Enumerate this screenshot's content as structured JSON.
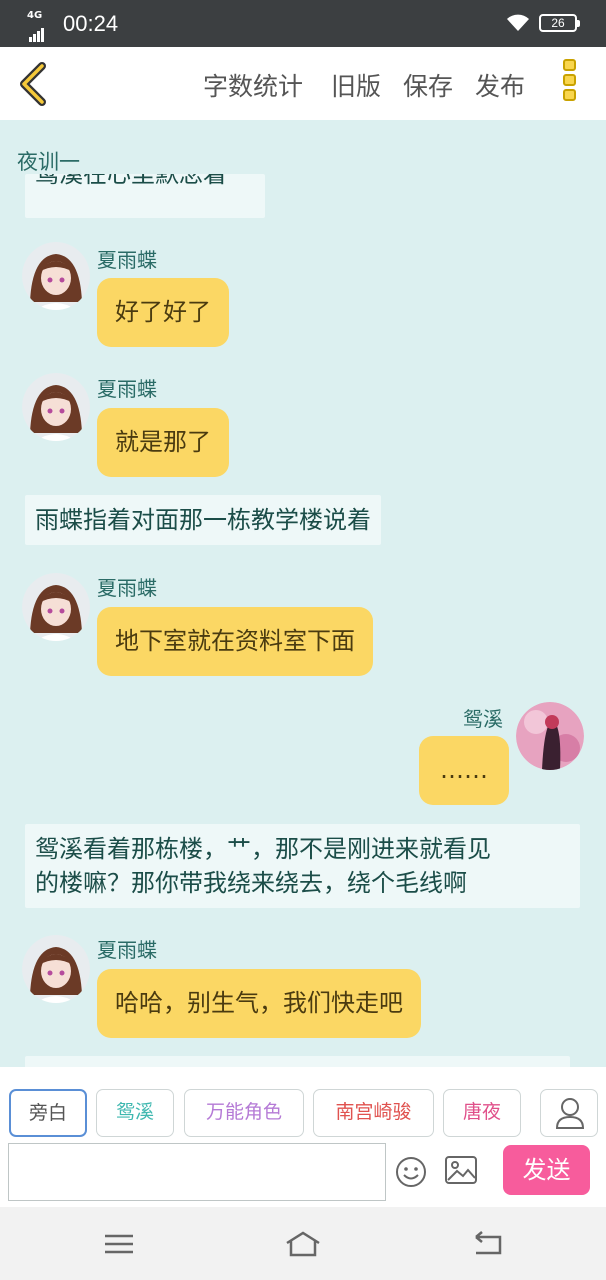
{
  "status_bar": {
    "network": "4G",
    "time": "00:24",
    "battery": "26"
  },
  "toolbar": {
    "word_count_label": "字数统计",
    "old_version_label": "旧版",
    "save_label": "保存",
    "publish_label": "发布"
  },
  "chat": {
    "title": "夜训一",
    "cut_off_text": "鸳溪在心里默念着",
    "messages": [
      {
        "speaker": "夏雨蝶",
        "text": "好了好了"
      },
      {
        "speaker": "夏雨蝶",
        "text": "就是那了"
      },
      {
        "narration": "雨蝶指着对面那一栋教学楼说着"
      },
      {
        "speaker": "夏雨蝶",
        "text": "地下室就在资料室下面"
      },
      {
        "speaker": "鸳溪",
        "text": "……"
      },
      {
        "narration_lines": [
          "鸳溪看着那栋楼，艹，那不是刚进来就看见",
          "的楼嘛？那你带我绕来绕去，绕个毛线啊"
        ]
      },
      {
        "speaker": "夏雨蝶",
        "text": "哈哈，别生气，我们快走吧"
      }
    ]
  },
  "characters": [
    {
      "name": "旁白",
      "color": "#555555"
    },
    {
      "name": "鸳溪",
      "color": "#3fb8b0"
    },
    {
      "name": "万能角色",
      "color": "#b57ad6"
    },
    {
      "name": "南宫崎骏",
      "color": "#e0524f"
    },
    {
      "name": "唐夜",
      "color": "#e0508a"
    }
  ],
  "input": {
    "placeholder": "",
    "send_label": "发送"
  },
  "colors": {
    "bubble": "#fbd764",
    "chat_bg": "#dcf0f0",
    "send": "#f75c9c"
  }
}
